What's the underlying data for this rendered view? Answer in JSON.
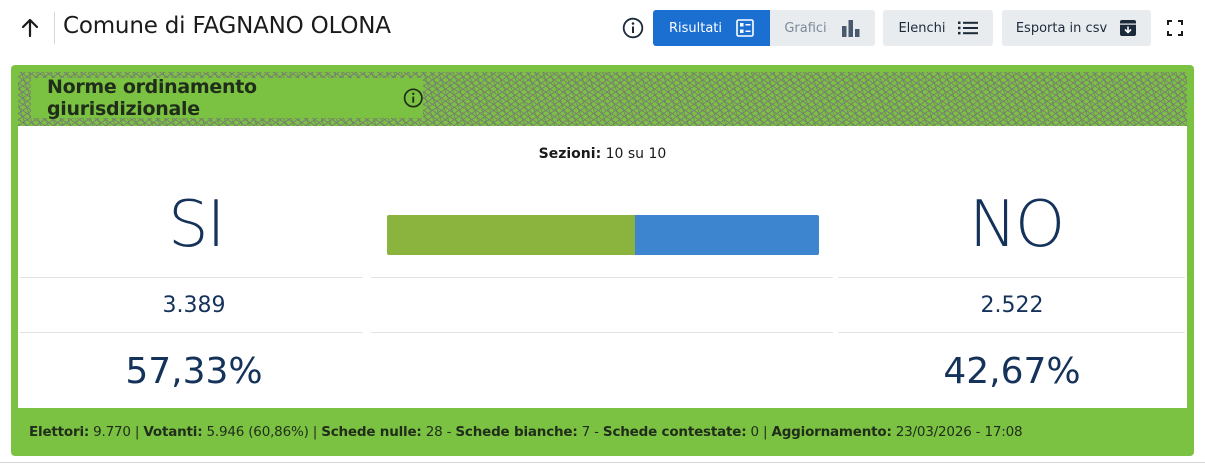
{
  "header": {
    "title": "Comune di FAGNANO OLONA",
    "buttons": {
      "risultati": "Risultati",
      "grafici": "Grafici",
      "elenchi": "Elenchi",
      "esporta": "Esporta in csv"
    }
  },
  "icons": {
    "back": "arrow-up-icon",
    "info": "info-circle-icon",
    "risultati": "list-grid-icon",
    "grafici": "bar-chart-icon",
    "elenchi": "list-icon",
    "esporta": "download-box-icon",
    "fullscreen": "fullscreen-icon"
  },
  "colors": {
    "accent": "#1a6fd1",
    "card_green": "#7cc242",
    "bar_si": "#8ab43e",
    "bar_no": "#3d85cf",
    "text_blue": "#15325a"
  },
  "card": {
    "title": "Norme ordinamento giurisdizionale",
    "sezioni_label": "Sezioni:",
    "sezioni_value": "10 su 10",
    "si": {
      "label": "SI",
      "votes": "3.389",
      "percent": "57,33%",
      "share": 0.5733
    },
    "no": {
      "label": "NO",
      "votes": "2.522",
      "percent": "42,67%",
      "share": 0.4267
    }
  },
  "footer": {
    "elettori_label": "Elettori:",
    "elettori_value": "9.770",
    "votanti_label": "Votanti:",
    "votanti_value": "5.946 (60,86%)",
    "nulle_label": "Schede nulle:",
    "nulle_value": "28",
    "bianche_label": "Schede bianche:",
    "bianche_value": "7",
    "contestate_label": "Schede contestate:",
    "contestate_value": "0",
    "aggiornamento_label": "Aggiornamento:",
    "aggiornamento_value": "23/03/2026 - 17:08"
  }
}
